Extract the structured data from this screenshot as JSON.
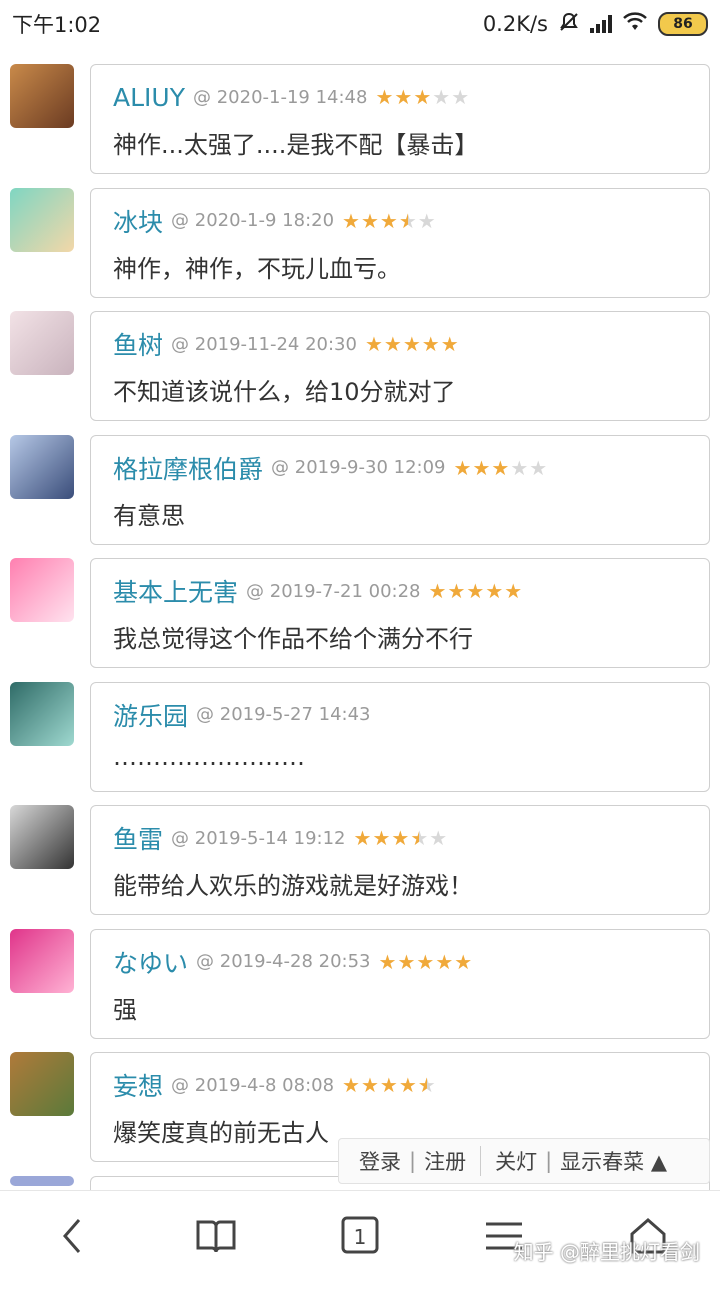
{
  "status": {
    "time": "下午1:02",
    "speed": "0.2K/s",
    "battery": "86"
  },
  "comments": [
    {
      "user": "ALIUY",
      "date": "@ 2020-1-19 14:48",
      "rating": 3,
      "text": "神作...太强了....是我不配【暴击】",
      "avatar_colors": [
        "#c98a4a",
        "#6b3b22"
      ]
    },
    {
      "user": "冰块",
      "date": "@ 2020-1-9 18:20",
      "rating": 3.5,
      "text": "神作，神作，不玩儿血亏。",
      "avatar_colors": [
        "#7fd6c2",
        "#f3d7a8"
      ]
    },
    {
      "user": "鱼树",
      "date": "@ 2019-11-24 20:30",
      "rating": 5,
      "text": "不知道该说什么，给10分就对了",
      "avatar_colors": [
        "#f2e2e6",
        "#c9b3bd"
      ]
    },
    {
      "user": "格拉摩根伯爵",
      "date": "@ 2019-9-30 12:09",
      "rating": 3,
      "text": "有意思",
      "avatar_colors": [
        "#b6c8e6",
        "#3a4d7a"
      ]
    },
    {
      "user": "基本上无害",
      "date": "@ 2019-7-21 00:28",
      "rating": 5,
      "text": "我总觉得这个作品不给个满分不行",
      "avatar_colors": [
        "#ff7fb0",
        "#ffe3ef"
      ]
    },
    {
      "user": "游乐园",
      "date": "@ 2019-5-27 14:43",
      "rating": 0,
      "text": "……………………",
      "avatar_colors": [
        "#2f6b67",
        "#9fd9d0"
      ]
    },
    {
      "user": "鱼雷",
      "date": "@ 2019-5-14 19:12",
      "rating": 3.5,
      "text": "能带给人欢乐的游戏就是好游戏！",
      "avatar_colors": [
        "#d8d8d8",
        "#333333"
      ]
    },
    {
      "user": "なゆい",
      "date": "@ 2019-4-28 20:53",
      "rating": 5,
      "text": "强",
      "avatar_colors": [
        "#e0348a",
        "#ffb3d4"
      ]
    },
    {
      "user": "妄想",
      "date": "@ 2019-4-8 08:08",
      "rating": 4.5,
      "text": "爆笑度真的前无古人",
      "avatar_colors": [
        "#b07a3a",
        "#5a7a3a"
      ]
    }
  ],
  "floating_bar": {
    "login": "登录",
    "register": "注册",
    "lights_off": "关灯",
    "show": "显示春菜 ▲"
  },
  "nav": {
    "tab_count": "1"
  },
  "watermark": "知乎 @醉里挑灯看剑",
  "colors": {
    "username": "#2b8cab",
    "star": "#f0a93a",
    "star_empty": "#d8d8d8"
  }
}
